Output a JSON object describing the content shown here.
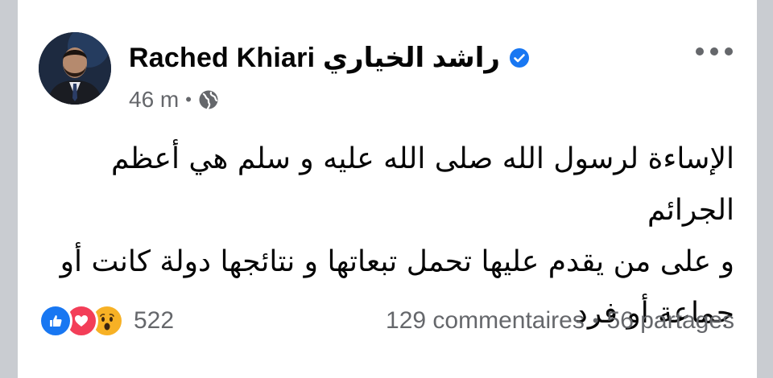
{
  "post": {
    "author": "Rached Khiari راشد الخياري",
    "time": "46 m",
    "meta_separator": "•",
    "text": "الإساءة لرسول الله صلى الله عليه و سلم هي أعظم الجرائم\nو على من يقدم عليها تحمل تبعاتها و نتائجها دولة كانت أو\nجماعة أو فرد",
    "audience_icon": "globe-icon",
    "verified": true
  },
  "engagement": {
    "reactions": [
      "like",
      "love",
      "wow"
    ],
    "reaction_count": "522",
    "comments": "129 commentaires",
    "separator": "•",
    "shares": "56 partages"
  },
  "colors": {
    "verified_blue": "#1877f2",
    "text_primary": "#050505",
    "text_secondary": "#65676b",
    "like_blue": "#1877f2",
    "love_red": "#f33e58",
    "wow_yellow": "#f7b125"
  }
}
